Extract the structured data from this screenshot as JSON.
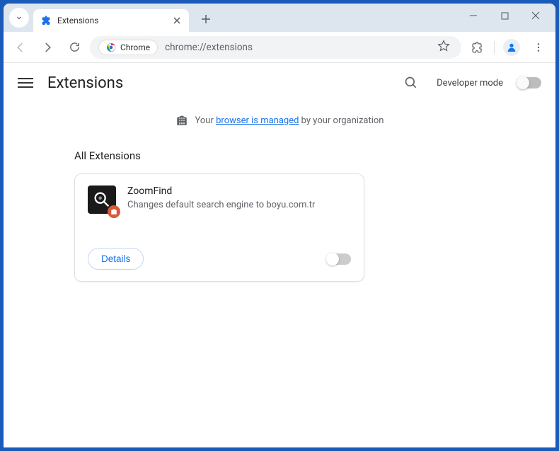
{
  "tab": {
    "title": "Extensions"
  },
  "address": {
    "chip_label": "Chrome",
    "url": "chrome://extensions"
  },
  "page": {
    "title": "Extensions",
    "dev_mode_label": "Developer mode"
  },
  "banner": {
    "prefix": "Your ",
    "link_text": "browser is managed",
    "suffix": " by your organization"
  },
  "section": {
    "title": "All Extensions"
  },
  "extension": {
    "name": "ZoomFind",
    "description": "Changes default search engine to boyu.com.tr",
    "details_label": "Details",
    "enabled": false
  }
}
